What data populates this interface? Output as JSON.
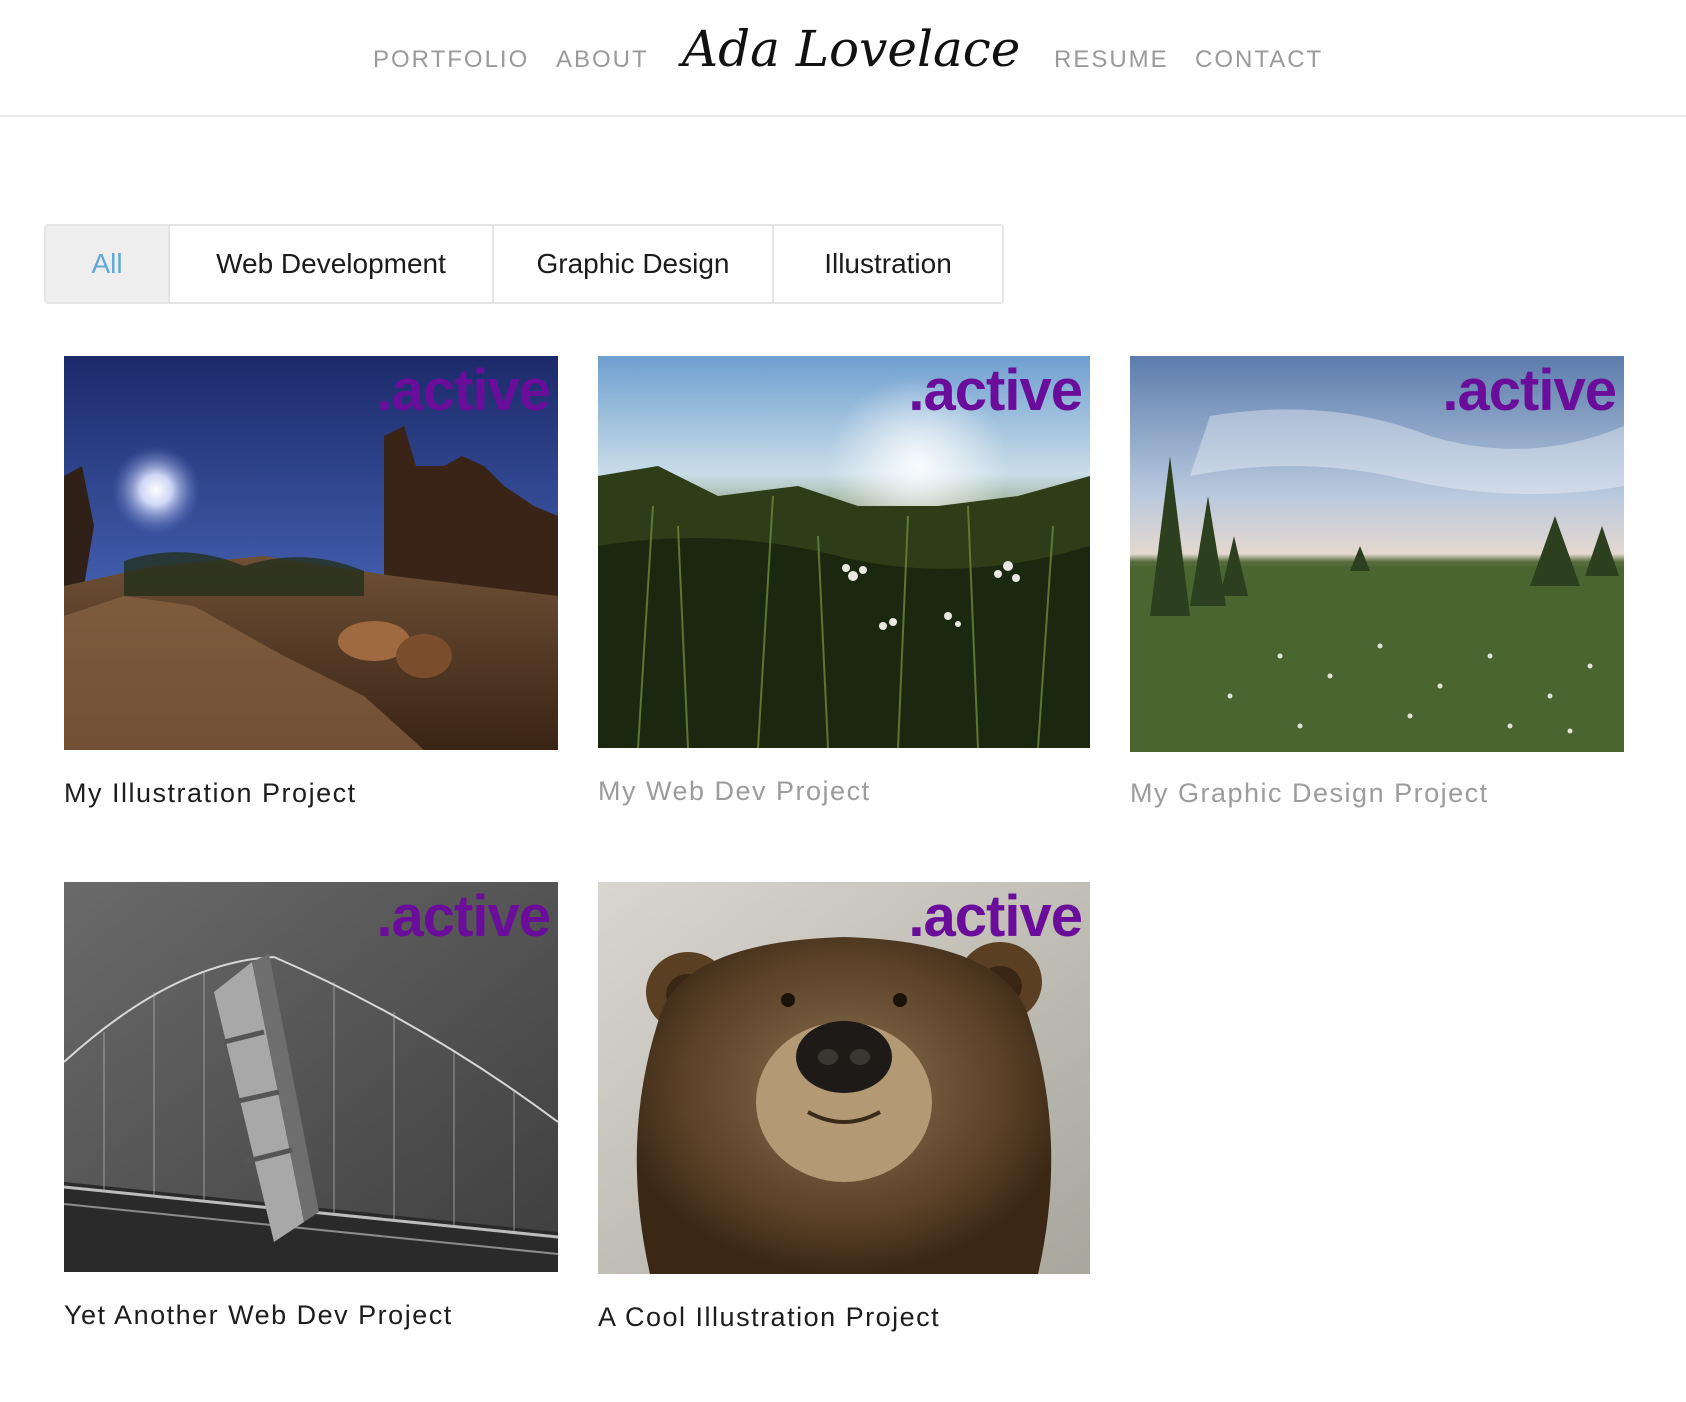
{
  "header": {
    "nav_left": [
      "PORTFOLIO",
      "ABOUT"
    ],
    "logo_text": "Ada Lovelace",
    "nav_right": [
      "RESUME",
      "CONTACT"
    ]
  },
  "filters": {
    "items": [
      "All",
      "Web Development",
      "Graphic Design",
      "Illustration"
    ],
    "active": "All"
  },
  "projects": [
    {
      "title": "My Illustration Project",
      "tag": ".active",
      "image": "desert-night-photo",
      "title_style": "dark"
    },
    {
      "title": "My Web Dev Project",
      "tag": ".active",
      "image": "meadow-grass-photo",
      "title_style": "dim"
    },
    {
      "title": "My Graphic Design Project",
      "tag": ".active",
      "image": "marsh-landscape-photo",
      "title_style": "dim"
    },
    {
      "title": "Yet Another Web Dev Project",
      "tag": ".active",
      "image": "bridge-aerial-photo",
      "title_style": "dark"
    },
    {
      "title": "A Cool Illustration Project",
      "tag": ".active",
      "image": "bear-portrait-photo",
      "title_style": "dark"
    }
  ],
  "colors": {
    "active_tag": "#6b0d9b",
    "filter_active_text": "#5fa9d8",
    "nav_text": "#9a9a9a"
  }
}
